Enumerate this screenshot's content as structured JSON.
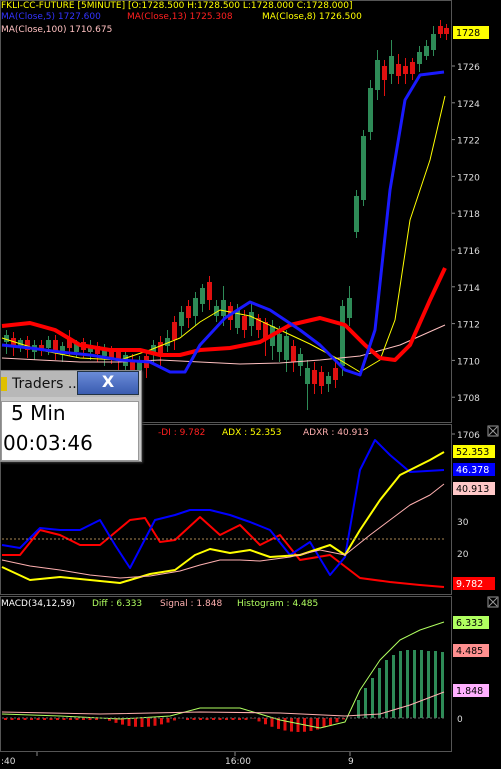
{
  "price_pane": {
    "header_line1": "FKLI-CC-FUTURE [5MINUTE] [O:1728.500 H:1728.500 L:1728.000 C:1728.000]",
    "ma5": "MA(Close,5) 1727.600",
    "ma13": "MA(Close,13) 1725.308",
    "ma8": "MA(Close,8) 1726.500",
    "ma100": "MA(Close,100) 1710.675",
    "last_price_tag": "1728",
    "y_ticks": [
      "1726",
      "1724",
      "1722",
      "1720",
      "1718",
      "1716",
      "1714",
      "1712",
      "1710",
      "1708",
      "1706"
    ]
  },
  "adx_pane": {
    "minus_di": "-DI : 9.782",
    "adx": "ADX : 52.353",
    "adxr": "ADXR : 40.913",
    "tags": [
      "52.353",
      "46.378",
      "40.913",
      "9.782"
    ],
    "y_ticks": [
      "30",
      "20",
      "10"
    ]
  },
  "macd_pane": {
    "title": "MACD(34,12,59)",
    "diff": "Diff : 6.333",
    "signal": "Signal : 1.848",
    "histogram": "Histogram : 4.485",
    "tags": [
      "6.333",
      "4.485",
      "1.848"
    ],
    "y_ticks": [
      "0"
    ]
  },
  "time_axis": {
    "labels": [
      ":40",
      "16:00",
      "9"
    ]
  },
  "popup": {
    "title": "Traders ...",
    "close_label": "X",
    "timeframe": "5 Min",
    "countdown": "00:03:46"
  },
  "colors": {
    "up_candle": "#2e8b57",
    "down_candle": "#e01010",
    "ma5": "#1a1aff",
    "ma13": "#ff0000",
    "ma8": "#ffff00",
    "ma100": "#ffc0c0",
    "minus_di": "#ff0000",
    "plus_di": "#0000ff",
    "adx": "#ffff00",
    "adxr": "#ffb0b0",
    "macd_diff": "#b0ff60",
    "macd_signal": "#ffb0b0"
  }
}
